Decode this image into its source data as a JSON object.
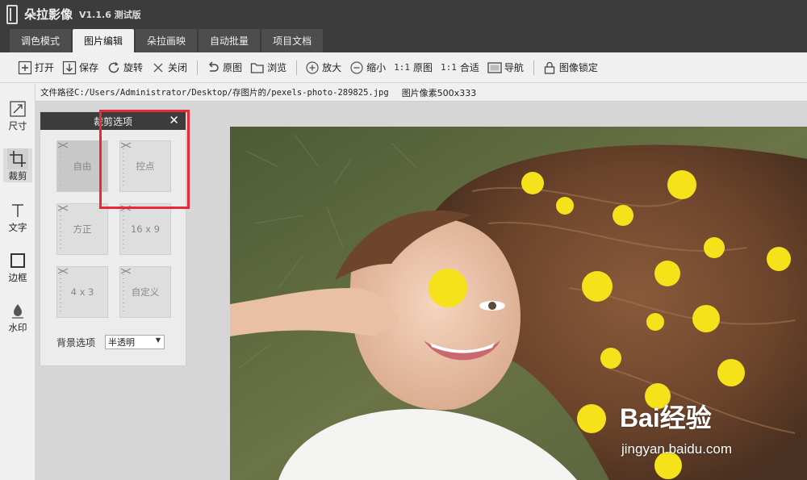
{
  "app": {
    "title": "朵拉影像",
    "version": "V1.1.6 测试版"
  },
  "tabs": [
    {
      "label": "调色模式"
    },
    {
      "label": "图片编辑",
      "active": true
    },
    {
      "label": "朵拉画映"
    },
    {
      "label": "自动批量"
    },
    {
      "label": "项目文档"
    }
  ],
  "toolbar": {
    "open": "打开",
    "save": "保存",
    "rotate": "旋转",
    "close": "关闭",
    "original": "原图",
    "browse": "浏览",
    "zoom_in": "放大",
    "zoom_out": "缩小",
    "ratio_original_prefix": "1:1",
    "ratio_original": "原图",
    "ratio_fit_prefix": "1:1",
    "ratio_fit": "合适",
    "navigate": "导航",
    "lock": "图像锁定"
  },
  "pathbar": {
    "path": "文件路径C:/Users/Administrator/Desktop/存图片的/pexels-photo-289825.jpg",
    "pixels": "图片像素500x333"
  },
  "left_tools": [
    {
      "label": "尺寸"
    },
    {
      "label": "裁剪",
      "active": true
    },
    {
      "label": "文字"
    },
    {
      "label": "边框"
    },
    {
      "label": "水印"
    }
  ],
  "crop_panel": {
    "title": "裁剪选项",
    "options": [
      "自由",
      "控点",
      "方正",
      "16 x 9",
      "4 x 3",
      "自定义"
    ],
    "selected": "自由",
    "bg_label": "背景选项",
    "bg_value": "半透明"
  },
  "watermark": {
    "brand": "Bai经验",
    "site": "jingyan.baidu.com"
  },
  "colors": {
    "titlebar": "#3c3c3c",
    "highlight": "#e8293a",
    "flower": "#f5e21a"
  }
}
